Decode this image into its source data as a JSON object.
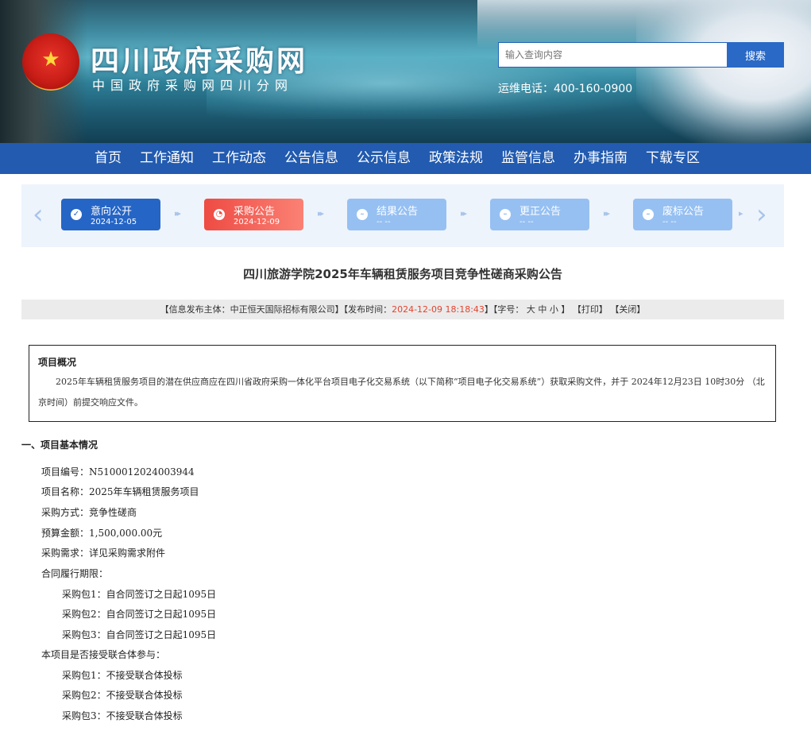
{
  "header": {
    "site_title": "四川政府采购网",
    "site_subtitle": "中国政府采购网四川分网",
    "search_placeholder": "输入查询内容",
    "search_button": "搜索",
    "hotline": "运维电话：400-160-0900"
  },
  "nav": {
    "items": [
      "首页",
      "工作通知",
      "工作动态",
      "公告信息",
      "公示信息",
      "政策法规",
      "监管信息",
      "办事指南",
      "下载专区"
    ]
  },
  "steps": [
    {
      "label": "意向公开",
      "date": "2024-12-05",
      "status": "done"
    },
    {
      "label": "采购公告",
      "date": "2024-12-09",
      "status": "current"
    },
    {
      "label": "结果公告",
      "date": "-- --",
      "status": "pending"
    },
    {
      "label": "更正公告",
      "date": "-- --",
      "status": "pending"
    },
    {
      "label": "废标公告",
      "date": "-- --",
      "status": "pending"
    }
  ],
  "article": {
    "title": "四川旅游学院2025年车辆租赁服务项目竞争性磋商采购公告",
    "info": {
      "publisher_prefix": "【信息发布主体：中正恒天国际招标有限公司】【发布时间：",
      "publish_time": "2024-12-09 18:18:43",
      "font_prefix": "】【字号：",
      "font_large": "大",
      "font_medium": "中",
      "font_small": "小",
      "font_suffix": "】",
      "print": "【打印】",
      "close": "【关闭】"
    },
    "overview": {
      "heading": "项目概况",
      "text": "2025年车辆租赁服务项目的潜在供应商应在四川省政府采购一体化平台项目电子化交易系统（以下简称“项目电子化交易系统”）获取采购文件，并于 2024年12月23日 10时30分 （北京时间）前提交响应文件。"
    },
    "section1": {
      "heading": "一、项目基本情况",
      "lines": [
        "项目编号：N5100012024003944",
        "项目名称：2025年车辆租赁服务项目",
        "采购方式：竞争性磋商",
        "预算金额：1,500,000.00元",
        "采购需求：详见采购需求附件",
        "合同履行期限：",
        "采购包1：自合同签订之日起1095日",
        "采购包2：自合同签订之日起1095日",
        "采购包3：自合同签订之日起1095日",
        "本项目是否接受联合体参与：",
        "采购包1：不接受联合体投标",
        "采购包2：不接受联合体投标",
        "采购包3：不接受联合体投标"
      ]
    }
  }
}
